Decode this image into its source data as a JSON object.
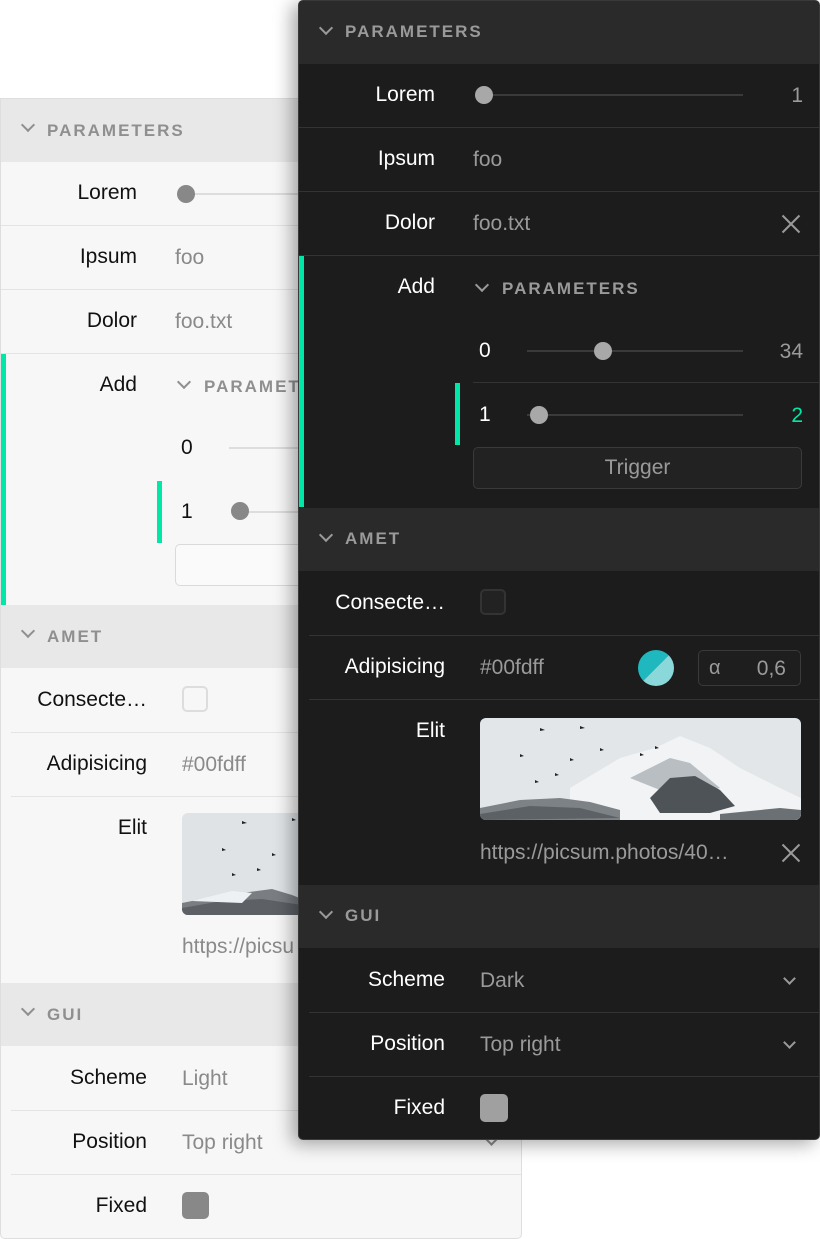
{
  "light_panel": {
    "sections": {
      "parameters": "PARAMETERS",
      "amet": "AMET",
      "gui": "GUI"
    },
    "rows": {
      "lorem": "Lorem",
      "ipsum": "Ipsum",
      "ipsum_value": "foo",
      "dolor": "Dolor",
      "dolor_value": "foo.txt",
      "add": "Add",
      "nested_title": "PARAMET",
      "nested_0": "0",
      "nested_1": "1",
      "consectetur": "Consecte…",
      "adipisicing": "Adipisicing",
      "adipisicing_value": "#00fdff",
      "elit": "Elit",
      "elit_url": "https://picsu",
      "scheme": "Scheme",
      "scheme_value": "Light",
      "position": "Position",
      "position_value": "Top right",
      "fixed": "Fixed"
    }
  },
  "dark_panel": {
    "sections": {
      "parameters": "PARAMETERS",
      "amet": "AMET",
      "gui": "GUI"
    },
    "rows": {
      "lorem": "Lorem",
      "lorem_value": "1",
      "ipsum": "Ipsum",
      "ipsum_value": "foo",
      "dolor": "Dolor",
      "dolor_value": "foo.txt",
      "add": "Add",
      "nested_title": "PARAMETERS",
      "nested_0": "0",
      "nested_0_value": "34",
      "nested_1": "1",
      "nested_1_value": "2",
      "trigger": "Trigger",
      "consectetur": "Consecte…",
      "adipisicing": "Adipisicing",
      "adipisicing_value": "#00fdff",
      "alpha_symbol": "α",
      "alpha_value": "0,6",
      "elit": "Elit",
      "elit_url": "https://picsum.photos/40…",
      "scheme": "Scheme",
      "scheme_value": "Dark",
      "position": "Position",
      "position_value": "Top right",
      "fixed": "Fixed"
    }
  },
  "colors": {
    "accent": "#00e8a8",
    "color_value": "#00fdff"
  },
  "icons": [
    "chevron-down-icon",
    "close-icon",
    "color-swatch"
  ]
}
